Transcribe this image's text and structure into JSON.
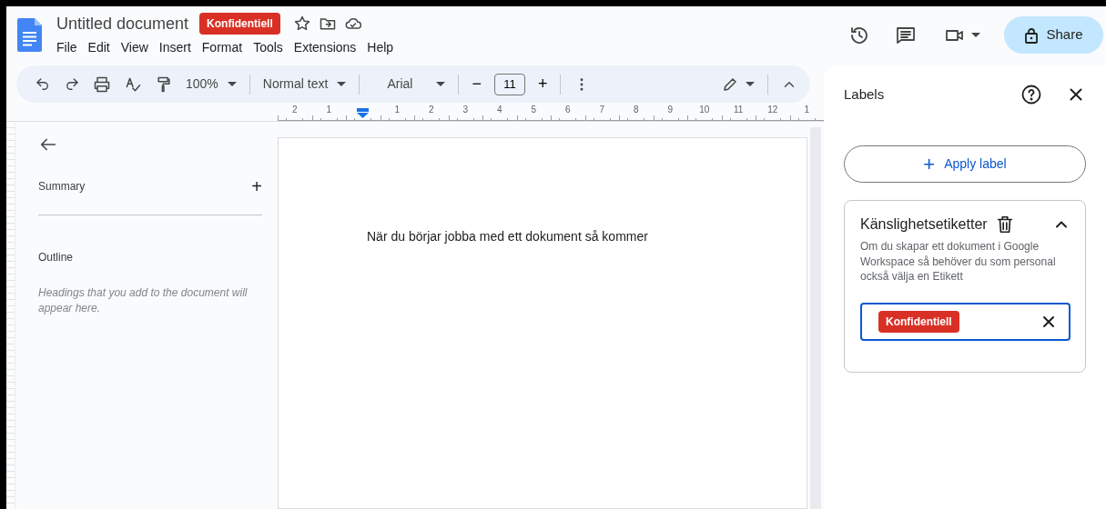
{
  "app": {
    "title": "Untitled document",
    "badge": "Konfidentiell",
    "menus": [
      "File",
      "Edit",
      "View",
      "Insert",
      "Format",
      "Tools",
      "Extensions",
      "Help"
    ],
    "share": "Share"
  },
  "toolbar": {
    "zoom": "100%",
    "style": "Normal text",
    "font": "Arial",
    "font_size": "11",
    "minus": "−",
    "plus": "+"
  },
  "ruler": {
    "items": [
      {
        "kind": "number",
        "label": "2"
      },
      {
        "kind": "number",
        "label": "1"
      },
      {
        "kind": "marker"
      },
      {
        "kind": "number",
        "label": "1"
      },
      {
        "kind": "number",
        "label": "2"
      },
      {
        "kind": "number",
        "label": "3"
      },
      {
        "kind": "number",
        "label": "4"
      },
      {
        "kind": "number",
        "label": "5"
      },
      {
        "kind": "number",
        "label": "6"
      },
      {
        "kind": "number",
        "label": "7"
      },
      {
        "kind": "number",
        "label": "8"
      },
      {
        "kind": "number",
        "label": "9"
      },
      {
        "kind": "number",
        "label": "10"
      },
      {
        "kind": "number",
        "label": "11"
      },
      {
        "kind": "number",
        "label": "12"
      },
      {
        "kind": "number",
        "label": "1"
      }
    ]
  },
  "outline_panel": {
    "summary": "Summary",
    "add": "+",
    "outline": "Outline",
    "hint": "Headings that you add to the document will appear here."
  },
  "document": {
    "text": "När du börjar jobba med ett dokument så kommer"
  },
  "labels_panel": {
    "title": "Labels",
    "apply_button": "Apply label",
    "apply_icon": "+",
    "section": {
      "title": "Känslighetsetiketter",
      "expanded": true,
      "description": "Om du skapar ett dokument i Google Workspace så behöver du som personal också välja en Etikett",
      "selected_label": "Konfidentiell"
    }
  }
}
